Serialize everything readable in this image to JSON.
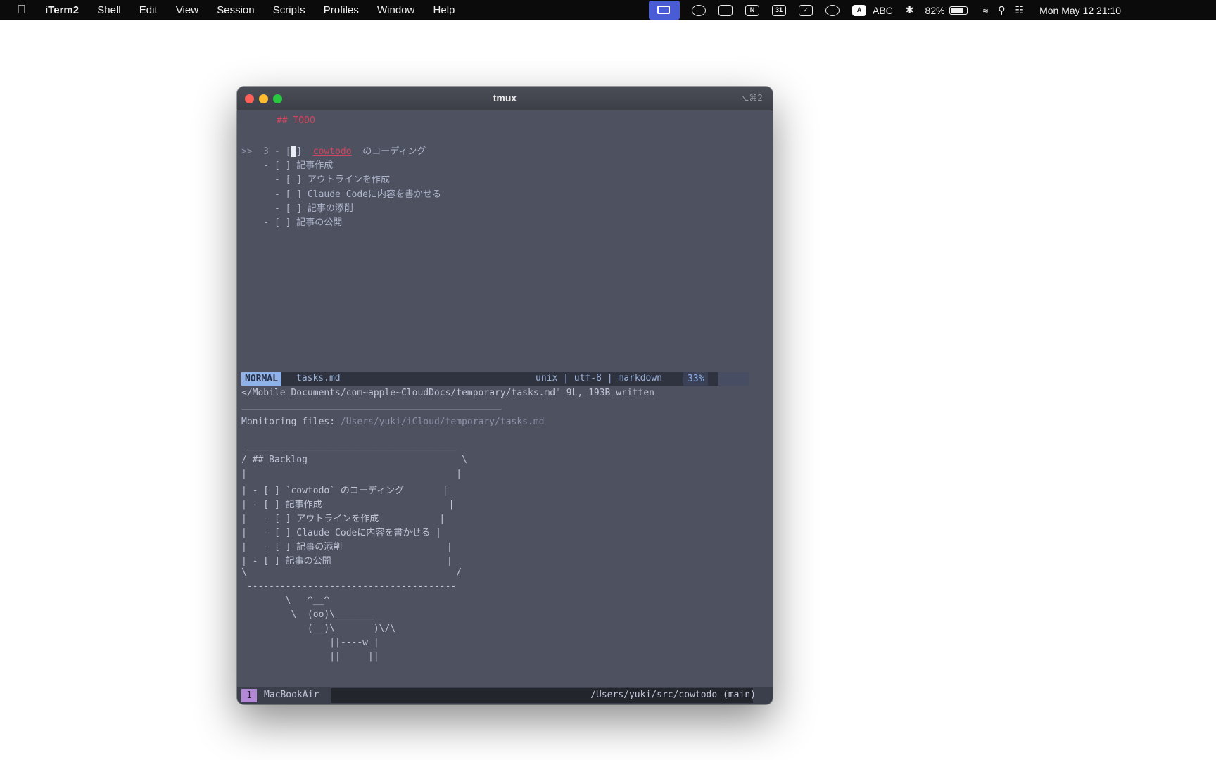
{
  "menubar": {
    "app_name": "iTerm2",
    "items": [
      "Shell",
      "Edit",
      "View",
      "Session",
      "Scripts",
      "Profiles",
      "Window",
      "Help"
    ],
    "status": {
      "notion_glyph": "N",
      "calendar_glyph": "31",
      "input_glyph": "A",
      "input_source": "ABC",
      "battery": "82%",
      "datetime": "Mon May 12  21:10"
    }
  },
  "window": {
    "title": "tmux",
    "shortcut": "⌥⌘2"
  },
  "vim": {
    "heading": "## TODO",
    "current_line_prefix": ">>  3 - [",
    "cursor_char": " ",
    "current_line_mid": "]  ",
    "current_line_code": "cowtodo",
    "current_line_rest": "  のコーディング",
    "lines": [
      "    - [ ] 記事作成",
      "      - [ ] アウトラインを作成",
      "      - [ ] Claude Codeに内容を書かせる",
      "      - [ ] 記事の添削",
      "    - [ ] 記事の公開"
    ],
    "status": {
      "mode": "NORMAL",
      "file": "tasks.md",
      "right": "unix | utf-8 | markdown",
      "percent": "33%"
    },
    "message": "</Mobile Documents/com~apple~CloudDocs/temporary/tasks.md\" 9L, 193B written"
  },
  "cowtodo": {
    "monitoring_label": "Monitoring files:",
    "monitoring_path": "/Users/yuki/iCloud/temporary/tasks.md",
    "box_lines": [
      " ______________________________________",
      "/ ## Backlog                            \\",
      "|                                      |",
      "| - [ ] `cowtodo` のコーディング       |",
      "| - [ ] 記事作成                       |",
      "|   - [ ] アウトラインを作成           |",
      "|   - [ ] Claude Codeに内容を書かせる |",
      "|   - [ ] 記事の添削                   |",
      "| - [ ] 記事の公開                     |",
      "\\                                      /",
      " --------------------------------------",
      "        \\   ^__^",
      "         \\  (oo)\\_______",
      "            (__)\\       )\\/\\",
      "                ||----w |",
      "                ||     ||"
    ]
  },
  "tmux": {
    "session_index": "1",
    "host": "MacBookAir",
    "path": "/Users/yuki/src/cowtodo (main)"
  }
}
